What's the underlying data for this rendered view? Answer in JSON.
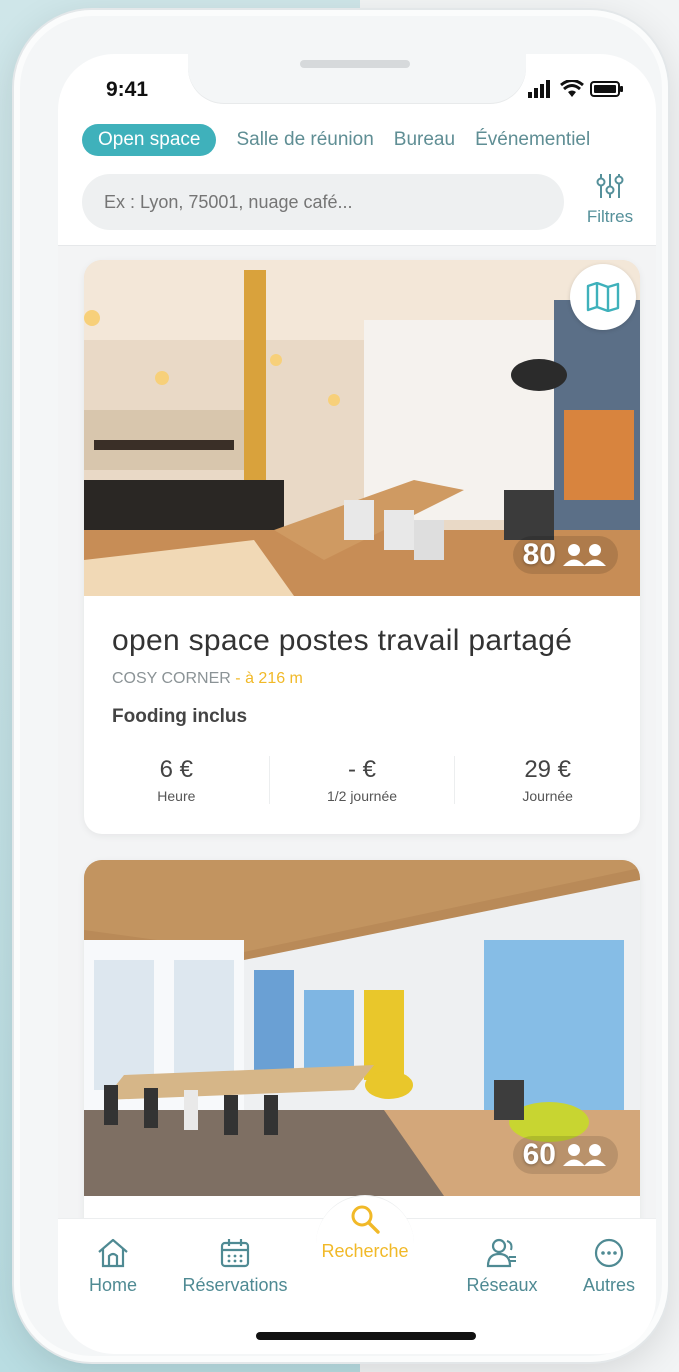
{
  "status_bar": {
    "time": "9:41"
  },
  "tabs": [
    {
      "label": "Open space",
      "active": true
    },
    {
      "label": "Salle de réunion",
      "active": false
    },
    {
      "label": "Bureau",
      "active": false
    },
    {
      "label": "Événementiel",
      "active": false
    }
  ],
  "search": {
    "placeholder": "Ex : Lyon, 75001, nuage café..."
  },
  "filters_label": "Filtres",
  "listings": [
    {
      "capacity": "80",
      "title": "open space postes travail partagé",
      "venue": "COSY CORNER",
      "distance": "- à 216 m",
      "feature": "Fooding inclus",
      "prices": [
        {
          "value": "6 €",
          "unit": "Heure"
        },
        {
          "value": "- €",
          "unit": "1/2 journée"
        },
        {
          "value": "29 €",
          "unit": "Journée"
        }
      ]
    },
    {
      "capacity": "60"
    }
  ],
  "nav": [
    {
      "label": "Home",
      "icon": "home-icon",
      "active": false
    },
    {
      "label": "Réservations",
      "icon": "calendar-icon",
      "active": false
    },
    {
      "label": "Recherche",
      "icon": "search-icon",
      "active": true
    },
    {
      "label": "Réseaux",
      "icon": "people-icon",
      "active": false
    },
    {
      "label": "Autres",
      "icon": "more-icon",
      "active": false
    }
  ],
  "colors": {
    "accent": "#3fb1bb",
    "active_nav": "#f1b928",
    "nav_text": "#4f8a93"
  }
}
